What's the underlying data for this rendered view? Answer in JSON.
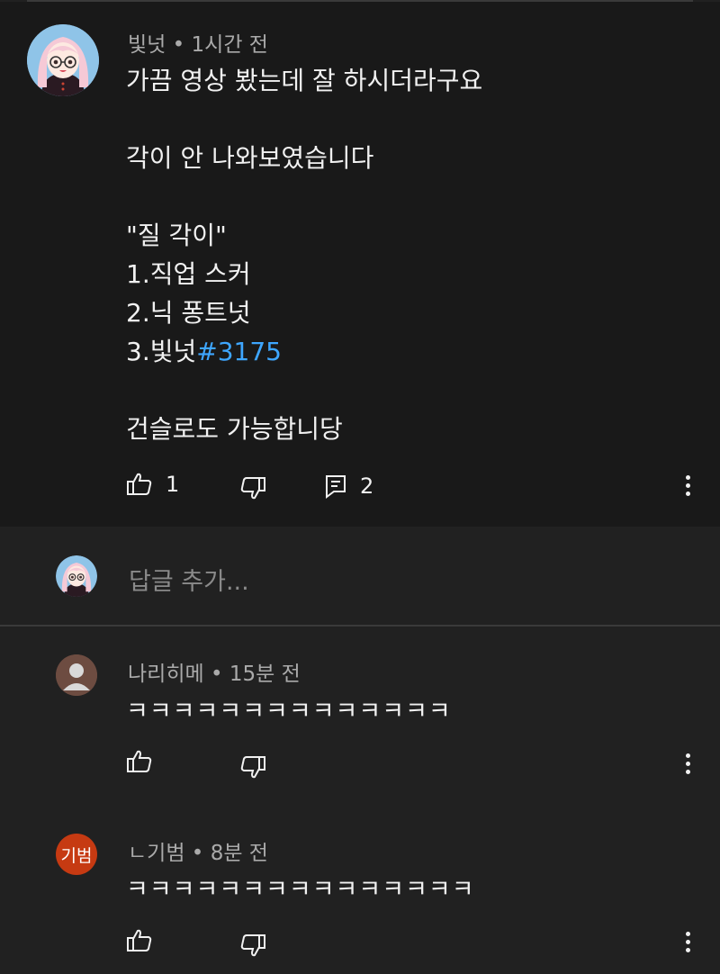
{
  "comment": {
    "author": "빛넛",
    "time": "1시간 전",
    "lines": [
      "가끔 영상 봤는데 잘 하시더라구요",
      "",
      "각이 안 나와보였습니다",
      "",
      "\"질 각이\"",
      "1.직업 스커",
      "2.닉 퐁트넛",
      "3.빛넛",
      "",
      "건슬로도 가능합니당"
    ],
    "hashtag": "#3175",
    "like_count": "1",
    "reply_count": "2"
  },
  "reply_box": {
    "placeholder": "답글 추가..."
  },
  "replies": [
    {
      "author": "나리히메",
      "time": "15분 전",
      "text": "ㅋㅋㅋㅋㅋㅋㅋㅋㅋㅋㅋㅋㅋㅋ"
    },
    {
      "author": "ㄴ기범",
      "time": "8분 전",
      "text": "ㅋㅋㅋㅋㅋㅋㅋㅋㅋㅋㅋㅋㅋㅋㅋ",
      "avatar_text": "기범",
      "avatar_color": "#c63a12"
    }
  ],
  "icons": {
    "like": "thumbs-up-icon",
    "dislike": "thumbs-down-icon",
    "reply": "comment-icon",
    "more": "more-vertical-icon"
  },
  "colors": {
    "background": "#212121",
    "comment_bg": "#191919",
    "hashtag": "#3ea6ff",
    "badge": "#c63a12"
  },
  "separator": " • "
}
